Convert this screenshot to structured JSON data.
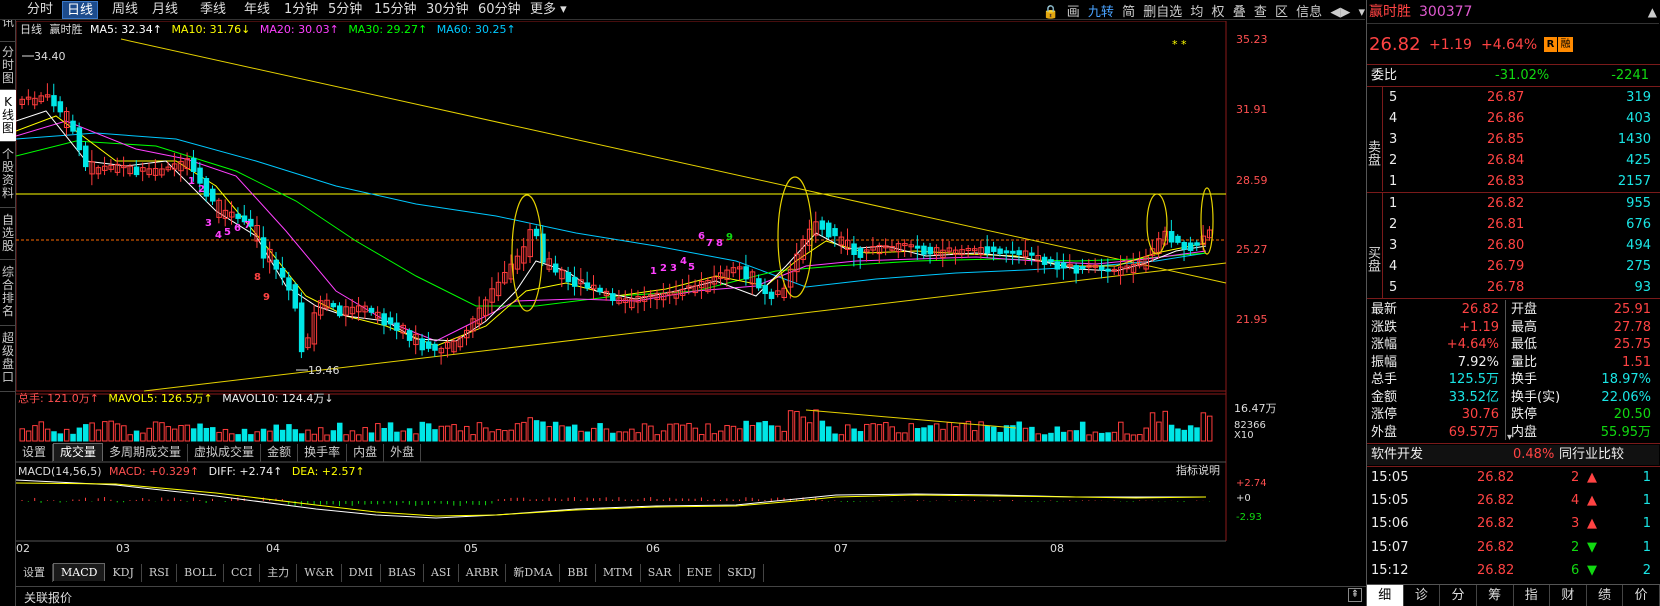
{
  "topbar": {
    "tabs": [
      "分时",
      "日线",
      "周线",
      "月线",
      "季线",
      "年线",
      "1分钟",
      "5分钟",
      "15分钟",
      "30分钟",
      "60分钟",
      "更多 ▾"
    ],
    "active_index": 1,
    "right_tools": [
      "🔒",
      "画",
      "九转",
      "简",
      "删自选",
      "均",
      "权",
      "叠",
      "查",
      "区",
      "信息",
      "◀▶",
      "▾"
    ]
  },
  "leftnav": [
    "资讯",
    "分时图",
    "K线图",
    "个股资料",
    "自选股",
    "综合排名",
    "超级盘口"
  ],
  "legend": {
    "period": "日线",
    "name": "赢时胜",
    "ma5": "MA5: 32.34↑",
    "ma10": "MA10: 31.76↓",
    "ma20": "MA20: 30.03↑",
    "ma30": "MA30: 29.27↑",
    "ma60": "MA60: 30.25↑"
  },
  "price_axis": [
    "35.23",
    "31.91",
    "28.59",
    "25.27",
    "21.95"
  ],
  "annotations": {
    "high": "34.40",
    "low": "19.46",
    "stars": "* *"
  },
  "volume_legend": {
    "total": "总手: 121.0万↑",
    "mavol5": "MAVOL5: 126.5万↑",
    "mavol10": "MAVOL10: 124.4万↓"
  },
  "volume_axis": [
    "16.47万",
    "82366",
    "X10"
  ],
  "volume_tabs": [
    "设置",
    "成交量",
    "多周期成交量",
    "虚拟成交量",
    "金额",
    "换手率",
    "内盘",
    "外盘"
  ],
  "macd_legend": {
    "label": "MACD(14,56,5)",
    "macd": "MACD: +0.329↑",
    "diff": "DIFF: +2.74↑",
    "dea": "DEA: +2.57↑",
    "explain": "指标说明"
  },
  "macd_axis": [
    "+2.74",
    "+0",
    "-2.93"
  ],
  "date_axis": [
    "02",
    "03",
    "04",
    "05",
    "06",
    "07",
    "08"
  ],
  "indicator_tabs": [
    "设置",
    "MACD",
    "KDJ",
    "RSI",
    "BOLL",
    "CCI",
    "主力",
    "W&R",
    "DMI",
    "BIAS",
    "ASI",
    "ARBR",
    "新DMA",
    "BBI",
    "MTM",
    "SAR",
    "ENE",
    "SKDJ"
  ],
  "bottom": {
    "label": "关联报价"
  },
  "stock": {
    "name": "赢时胜",
    "code": "300377",
    "price": "26.82",
    "change": "+1.19",
    "pct": "+4.64%",
    "badge1": "R",
    "badge2": "融",
    "weibi_label": "委比",
    "weibi": "-31.02%",
    "weicha": "-2241",
    "sell_label": "卖盘",
    "sell": [
      [
        "5",
        "26.87",
        "319"
      ],
      [
        "4",
        "26.86",
        "403"
      ],
      [
        "3",
        "26.85",
        "1430"
      ],
      [
        "2",
        "26.84",
        "425"
      ],
      [
        "1",
        "26.83",
        "2157"
      ]
    ],
    "buy_label": "买盘",
    "buy": [
      [
        "1",
        "26.82",
        "955"
      ],
      [
        "2",
        "26.81",
        "676"
      ],
      [
        "3",
        "26.80",
        "494"
      ],
      [
        "4",
        "26.79",
        "275"
      ],
      [
        "5",
        "26.78",
        "93"
      ]
    ],
    "quote": [
      [
        "最新",
        "26.82",
        "开盘",
        "25.91"
      ],
      [
        "涨跌",
        "+1.19",
        "最高",
        "27.78"
      ],
      [
        "涨幅",
        "+4.64%",
        "最低",
        "25.75"
      ],
      [
        "振幅",
        "7.92%",
        "量比",
        "1.51"
      ],
      [
        "总手",
        "125.5万",
        "换手",
        "18.97%"
      ],
      [
        "金额",
        "33.52亿",
        "换手(实)",
        "22.06%"
      ],
      [
        "涨停",
        "30.76",
        "跌停",
        "20.50"
      ],
      [
        "外盘",
        "69.57万",
        "内盘",
        "55.95万"
      ]
    ],
    "sector": {
      "name": "软件开发",
      "pct": "0.48%",
      "rank": "同行业比较"
    },
    "ticks": [
      [
        "15:05",
        "26.82",
        "2",
        "up",
        "1"
      ],
      [
        "15:05",
        "26.82",
        "4",
        "up",
        "1"
      ],
      [
        "15:06",
        "26.82",
        "3",
        "up",
        "1"
      ],
      [
        "15:07",
        "26.82",
        "2",
        "down",
        "1"
      ],
      [
        "15:12",
        "26.82",
        "6",
        "down",
        "2"
      ]
    ],
    "bottom_tabs": [
      "细",
      "诊",
      "分",
      "筹",
      "指",
      "财",
      "绩",
      "价"
    ]
  },
  "colors": {
    "up": "#ff3c3c",
    "down": "#00e6e6",
    "ma5": "#ffffff",
    "ma10": "#ffff00",
    "ma20": "#ff40ff",
    "ma30": "#00ff00",
    "ma60": "#00c8ff"
  }
}
